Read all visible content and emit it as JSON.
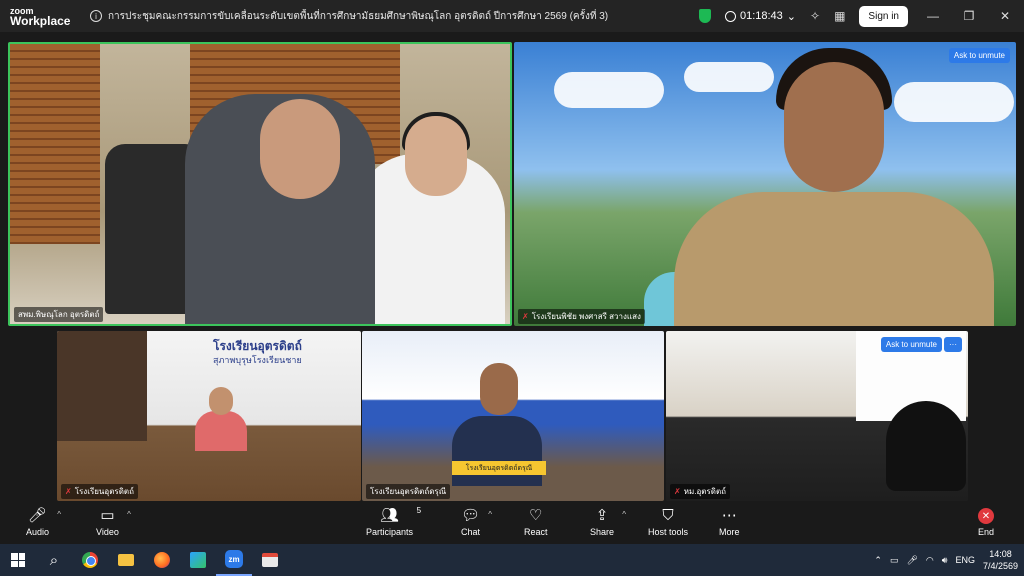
{
  "titlebar": {
    "logo_line1": "zoom",
    "logo_line2": "Workplace",
    "meeting_title": "การประชุมคณะกรรมการขับเคลื่อนระดับเขตพื้นที่การศึกษามัธยมศึกษาพิษณุโลก อุตรดิตถ์ ปีการศึกษา 2569 (ครั้งที่ 3)",
    "timer": "01:18:43",
    "sign_in": "Sign in"
  },
  "participants": {
    "tile1_name": "สพม.พิษณุโลก อุตรดิตถ์",
    "tile2_name": "โรงเรียนพิชัย พงศาสรี สวางแสง",
    "tile2_unmute": "Ask to unmute",
    "tile3_name": "โรงเรียนอุตรดิตถ์",
    "tile3_school": "โรงเรียนอุตรดิตถ์",
    "tile3_school_sub": "สุภาพบุรุษโรงเรียนชาย",
    "tile4_name": "โรงเรียนอุตรดิตถ์ดรุณี",
    "tile4_plate": "โรงเรียนอุตรดิตถ์ดรุณี",
    "tile5_name": "หม.อุตรดิตถ์",
    "tile5_unmute": "Ask to unmute",
    "more": "···"
  },
  "controls": {
    "audio": "Audio",
    "video": "Video",
    "participants": "Participants",
    "participants_count": "5",
    "chat": "Chat",
    "react": "React",
    "share": "Share",
    "host_tools": "Host tools",
    "more": "More",
    "end": "End"
  },
  "taskbar": {
    "zm_label": "zm",
    "lang": "ENG",
    "time": "14:08",
    "date": "7/4/2569"
  }
}
